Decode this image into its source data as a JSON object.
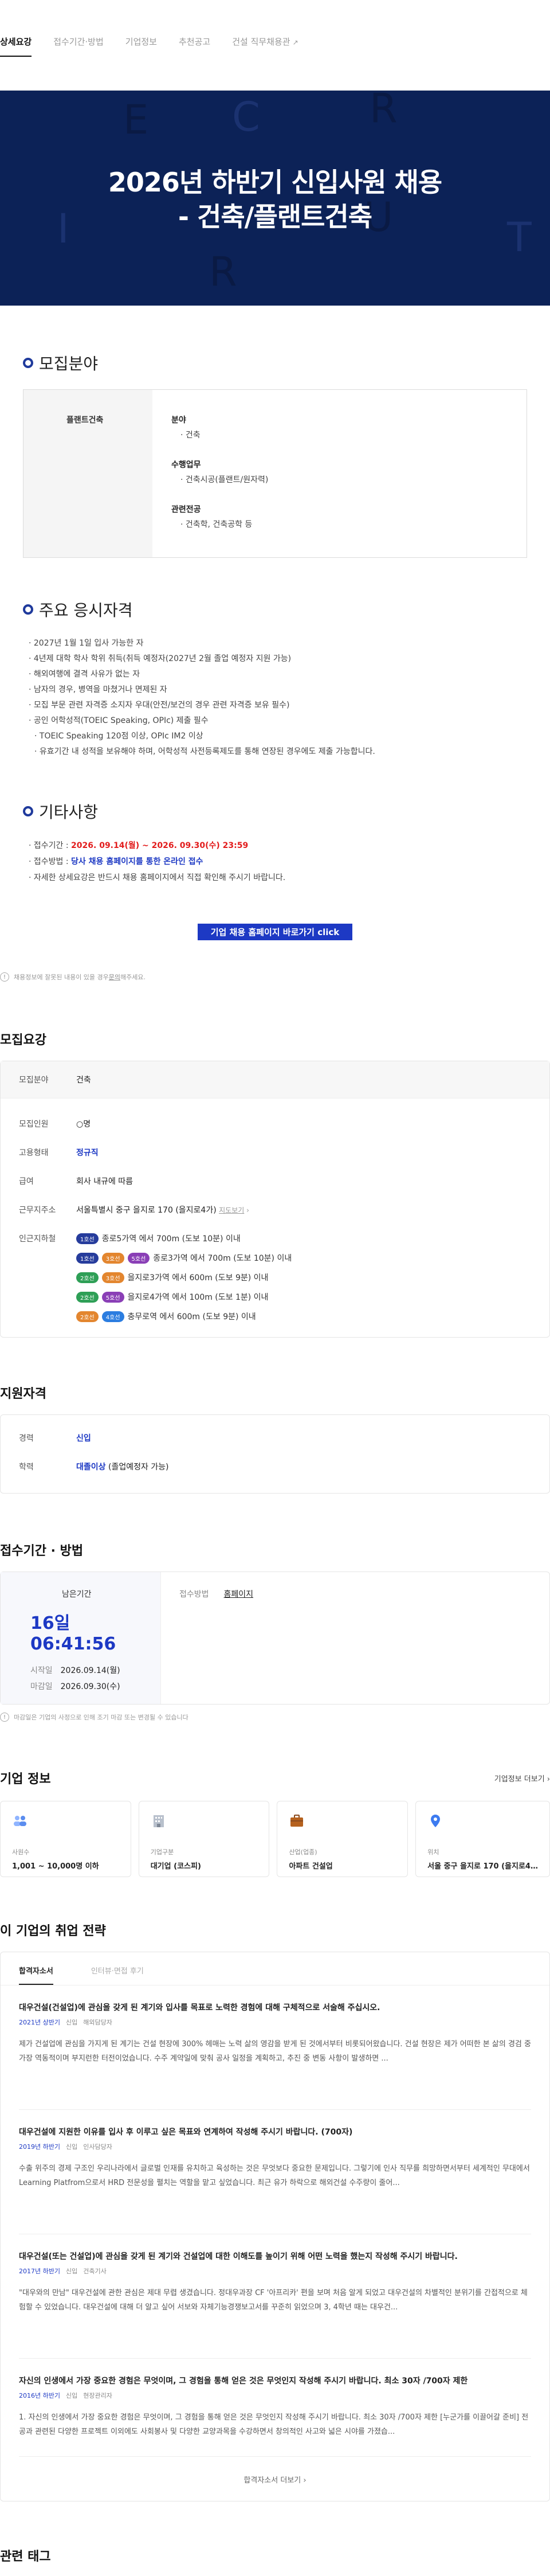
{
  "tabs": [
    "상세요강",
    "접수기간·방법",
    "기업정보",
    "추천공고",
    "건설 직무채용관"
  ],
  "hero": {
    "title_line1": "2026년 하반기 신입사원 채용",
    "title_line2": "- 건축/플랜트건축",
    "deco_letters": [
      "E",
      "R",
      "C",
      "I",
      "T",
      "U",
      "R",
      "T"
    ]
  },
  "recruit_field": {
    "title": "모집분야",
    "name": "플랜트건축",
    "labels": [
      "분야",
      "수행업무",
      "관련전공"
    ],
    "values": [
      "· 건축",
      "· 건축시공(플랜트/원자력)",
      "· 건축학, 건축공학 등"
    ]
  },
  "qualifications": {
    "title": "주요 응시자격",
    "items": [
      "· 2027년 1월 1일 입사 가능한 자",
      "· 4년제 대학 학사 학위 취득(취득 예정자(2027년 2월 졸업 예정자 지원 가능)",
      "· 해외여행에 결격 사유가 없는 자",
      "· 남자의 경우, 병역을 마쳤거나 면제된 자",
      "· 모집 부문 관련 자격증 소지자 우대(안전/보건의 경우 관련 자격증 보유 필수)",
      "· 공인 어학성적(TOEIC Speaking, OPIc) 제출 필수",
      "  · TOEIC Speaking 120점 이상, OPIc IM2 이상",
      "  · 유효기간 내 성적을 보유해야 하며, 어학성적 사전등록제도를 통해 연장된 경우에도 제출 가능합니다."
    ]
  },
  "etc": {
    "title": "기타사항",
    "period_label": "· 접수기간 : ",
    "period_value": "2026. 09.14(월) ~ 2026. 09.30(수) 23:59",
    "method_label": "· 접수방법 : ",
    "method_value": "당사 채용 홈페이지를 통한 온라인 접수",
    "note": "· 자세한 상세요강은 반드시 채용 홈페이지에서 직접 확인해 주시기 바랍니다.",
    "button": "기업 채용 홈페이지 바로가기 click"
  },
  "report_notice": {
    "text": "채용정보에 잘못된 내용이 있을 경우 ",
    "link": "문의",
    "tail": "해주세요."
  },
  "summary": {
    "title": "모집요강",
    "field_label": "모집분야",
    "field_value": "건축",
    "count_label": "모집인원",
    "count_value": "○명",
    "type_label": "고용형태",
    "type_value": "정규직",
    "salary_label": "급여",
    "salary_value": "회사 내규에 따름",
    "addr_label": "근무지주소",
    "addr_value": "서울특별시 중구 을지로 170 (을지로4가)",
    "map_link": "지도보기",
    "subway_label": "인근지하철",
    "subways": [
      {
        "badges": [
          {
            "t": "1호선",
            "c": "b1"
          }
        ],
        "text": "종로5가역 에서 700m (도보 10분) 이내"
      },
      {
        "badges": [
          {
            "t": "1호선",
            "c": "b1"
          },
          {
            "t": "3호선",
            "c": "b3"
          },
          {
            "t": "5호선",
            "c": "b5a"
          }
        ],
        "text": "종로3가역 에서 700m (도보 10분) 이내"
      },
      {
        "badges": [
          {
            "t": "2호선",
            "c": "b4"
          },
          {
            "t": "3호선",
            "c": "b3"
          }
        ],
        "text": "을지로3가역 에서 600m (도보 9분) 이내"
      },
      {
        "badges": [
          {
            "t": "2호선",
            "c": "b4"
          },
          {
            "t": "5호선",
            "c": "b5a"
          }
        ],
        "text": "을지로4가역 에서 100m (도보 1분) 이내"
      },
      {
        "badges": [
          {
            "t": "2호선",
            "c": "b3"
          },
          {
            "t": "4호선",
            "c": "bsin"
          }
        ],
        "text": "충무로역 에서 600m (도보 9분) 이내"
      }
    ]
  },
  "qualify": {
    "title": "지원자격",
    "career_label": "경력",
    "career_value": "신입",
    "edu_label": "학력",
    "edu_value": "대졸이상",
    "edu_extra": " (졸업예정자 가능)"
  },
  "apply": {
    "title": "접수기간 · 방법",
    "remain_label": "남은기간",
    "remain_value": "16일 06:41:56",
    "start_label": "시작일",
    "start_value": "2026.09.14(월)",
    "end_label": "마감일",
    "end_value": "2026.09.30(수)",
    "method_label": "접수방법",
    "method_value": "홈페이지",
    "notice": "마감일은 기업의 사정으로 인해 조기 마감 또는 변경될 수 있습니다"
  },
  "company": {
    "title": "기업 정보",
    "more": "기업정보 더보기",
    "cards": [
      {
        "label": "사원수",
        "value": "1,001 ~ 10,000명 이하",
        "icon": "people-icon"
      },
      {
        "label": "기업구분",
        "value": "대기업 (코스피)",
        "icon": "building-icon"
      },
      {
        "label": "산업(업종)",
        "value": "아파트 건설업",
        "icon": "briefcase-icon"
      },
      {
        "label": "위치",
        "value": "서울 중구 을지로 170 (을지로4…",
        "icon": "location-icon"
      }
    ]
  },
  "strategy": {
    "title": "이 기업의 취업 전략",
    "tabs": [
      "합격자소서",
      "인터뷰·면접 후기"
    ],
    "items": [
      {
        "q": "대우건설(건설업)에 관심을 갖게 된 계기와 입사를 목표로 노력한 경험에 대해 구체적으로 서술해 주십시오.",
        "y": "2021년 상반기",
        "m": [
          "신입",
          "해외담당자"
        ],
        "b": "제가 건설업에 관심을 가지게 된 계기는 건설 현장에 300% 헤매는 노력 삶의 영감을 받게 된 것에서부터 비롯되어왔습니다. 건설 현장은 제가 어떠한 본 삶의 경검 중 가장 역동적이며 부지런한 터전이었습니다. 수주 계약일에 맞춰 공사 일정을 계획하고, 추진 중 변동 사항이 발생하면 ..."
      },
      {
        "q": "대우건설에 지원한 이유를 입사 후 이루고 싶은 목표와 연계하여 작성해 주시기 바랍니다. (700자)",
        "y": "2019년 하반기",
        "m": [
          "신입",
          "인사담당자"
        ],
        "b": "수출 위주의 경제 구조인 우리나라에서 글로벌 인재를 유치하고 육성하는 것은 무엇보다 중요한 문제입니다. 그렇기에 인사 직무를 희망하면서부터 세계적인 무대에서 Learning Platfrom으로서 HRD 전문성을 펼치는 역할을 맡고 싶었습니다. 최근 유가 하락으로 해외건설 수주량이 줄어..."
      },
      {
        "q": "대우건설(또는 건설업)에 관심을 갖게 된 계기와 건설업에 대한 이해도를 높이기 위해 어떤 노력을 했는지 작성해 주시기 바랍니다.",
        "y": "2017년 하반기",
        "m": [
          "신입",
          "건축기사"
        ],
        "b": "\"대우와의 만남\" 대우건설에 관한 관심은 제대 무렵 생겼습니다. 정대우과장 CF '아프리카' 편을 보며 처음 알게 되었고 대우건설의 차별적인 분위기를 간접적으로 체험할 수 있었습니다. 대우건설에 대해 더 알고 싶어 서보와 자체기능경쟁보고서를 꾸준히 읽었으며 3, 4학년 때는 대우건..."
      },
      {
        "q": "자신의 인생에서 가장 중요한 경험은 무엇이며, 그 경험을 통해 얻은 것은 무엇인지 작성해 주시기 바랍니다. 최소 30자 /700자 제한",
        "y": "2016년 하반기",
        "m": [
          "신입",
          "현장관리자"
        ],
        "b": "1. 자신의 인생에서 가장 중요한 경험은 무엇이며, 그 경험을 통해 얻은 것은 무엇인지 작성해 주시기 바랍니다. 최소 30자 /700자 제한 [누군가를 이끌어갈 준비] 전공과 관련된 다양한 프로젝트 이외에도 사회봉사 및 다양한 교양과목을 수강하면서 창의적인 사고와 넓은 시야를 가졌습..."
      }
    ],
    "more": "합격자소서 더보기"
  },
  "tags_title": "관련 태그"
}
